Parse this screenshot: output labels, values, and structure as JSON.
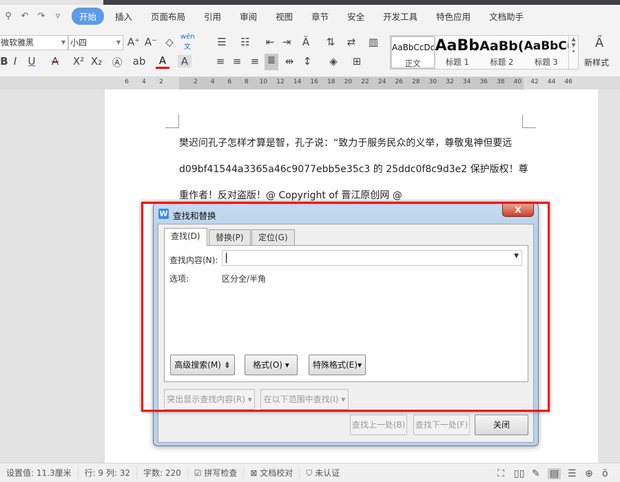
{
  "menu": {
    "quick_icons": [
      "search-icon",
      "undo-icon",
      "redo-icon",
      "customize-icon"
    ],
    "tabs": [
      "开始",
      "插入",
      "页面布局",
      "引用",
      "审阅",
      "视图",
      "章节",
      "安全",
      "开发工具",
      "特色应用",
      "文档助手"
    ]
  },
  "toolbar": {
    "font_name": "微软雅黑",
    "font_size": "小四",
    "styles": [
      {
        "preview": "AaBbCcDd",
        "name": "正文"
      },
      {
        "preview": "AaBb",
        "name": "标题 1"
      },
      {
        "preview": "AaBb(",
        "name": "标题 2"
      },
      {
        "preview": "AaBbC(",
        "name": "标题 3"
      }
    ],
    "new_style": "新样式",
    "phonetic": "wén"
  },
  "ruler": {
    "ticks": [
      "6",
      "4",
      "2",
      "2",
      "4",
      "6",
      "8",
      "10",
      "12",
      "14",
      "16",
      "18",
      "20",
      "22",
      "24",
      "26",
      "28",
      "30",
      "32",
      "34",
      "36",
      "38",
      "40",
      "42",
      "44",
      "46"
    ]
  },
  "document": {
    "lines": [
      "樊迟问孔子怎样才算是智，孔子说：“致力于服务民众的义举，尊敬鬼神但要远",
      "d09bf41544a3365a46c9077ebb5e35c3 的 25ddc0f8c9d3e2  保护版权！尊",
      "重作者！反对盗版！@ Copyright of  晋江原创网  @"
    ]
  },
  "dialog": {
    "title": "查找和替换",
    "close": "X",
    "tabs": [
      "查找(D)",
      "替换(P)",
      "定位(G)"
    ],
    "find_label": "查找内容(N):",
    "find_value": "",
    "options_label": "选项:",
    "options_value": "区分全/半角",
    "advanced": "高级搜索(M)",
    "format": "格式(O)",
    "special": "特殊格式(E)",
    "highlight": "突出显示查找内容(R)",
    "find_in": "在以下范围中查找(I)",
    "find_prev": "查找上一处(B)",
    "find_next": "查找下一处(F)",
    "close_btn": "关闭",
    "highlight_color": "#ff0000"
  },
  "status": {
    "items": [
      "设置值: 11.3厘米",
      "行: 9  列: 32",
      "字数: 220",
      "拼写检查",
      "文档校对",
      "未认证"
    ]
  }
}
